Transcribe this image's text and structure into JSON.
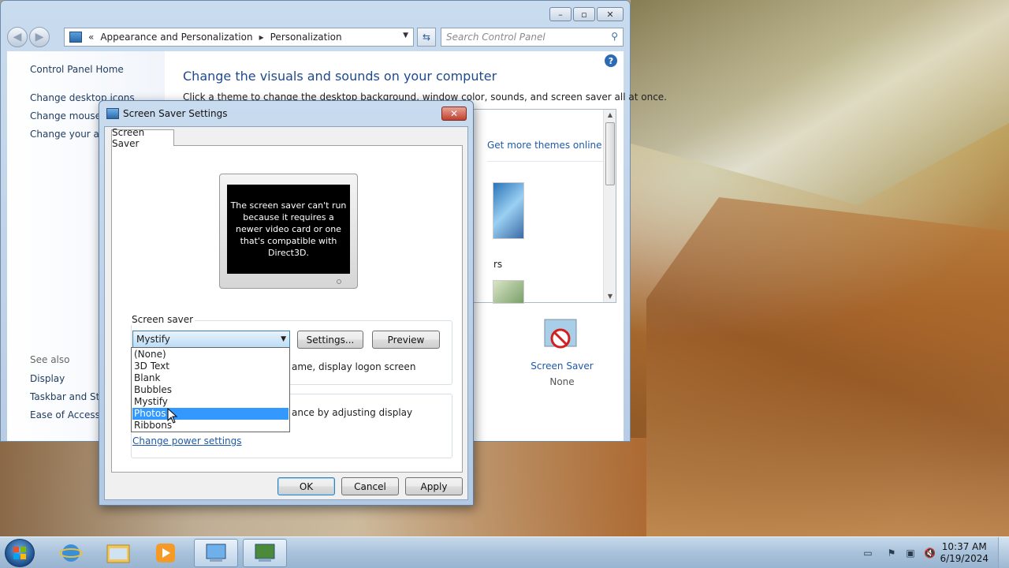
{
  "control_panel": {
    "breadcrumb": [
      "Appearance and Personalization",
      "Personalization"
    ],
    "search_placeholder": "Search Control Panel",
    "sidebar": {
      "home": "Control Panel Home",
      "links": [
        "Change desktop icons",
        "Change mouse p",
        "Change your acc"
      ],
      "see_also_label": "See also",
      "see_also": [
        "Display",
        "Taskbar and Star",
        "Ease of Access C"
      ]
    },
    "main": {
      "title": "Change the visuals and sounds on your computer",
      "description": "Click a theme to change the desktop background, window color, sounds, and screen saver all at once.",
      "get_more_themes": "Get more themes online",
      "partial_text": "rs",
      "screen_saver_label": "Screen Saver",
      "screen_saver_value": "None"
    }
  },
  "dialog": {
    "title": "Screen Saver Settings",
    "close_label": "✕",
    "tab": "Screen Saver",
    "preview_message": "The screen saver can't run because it requires a newer video card or one that's compatible with Direct3D.",
    "group_label": "Screen saver",
    "selected": "Mystify",
    "settings_button": "Settings...",
    "preview_button": "Preview",
    "logon_text": "ame, display logon screen",
    "power_text": "ance by adjusting display",
    "power_link": "Change power settings",
    "ok": "OK",
    "cancel": "Cancel",
    "apply": "Apply",
    "options": [
      "(None)",
      "3D Text",
      "Blank",
      "Bubbles",
      "Mystify",
      "Photos",
      "Ribbons"
    ],
    "highlighted_option": "Photos"
  },
  "taskbar": {
    "time": "10:37 AM",
    "date": "6/19/2024"
  },
  "icons": {
    "back": "back-arrow-icon",
    "forward": "forward-arrow-icon",
    "search": "search-icon",
    "help": "help-icon",
    "refresh": "refresh-icon"
  }
}
